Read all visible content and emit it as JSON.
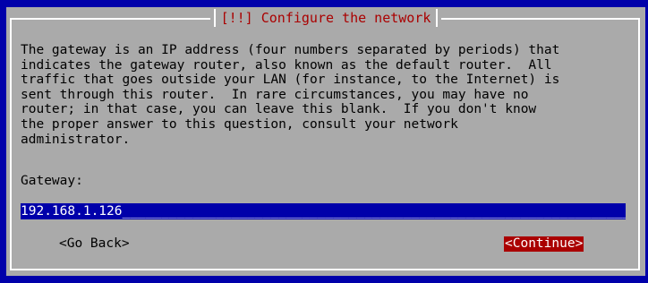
{
  "dialog": {
    "title": "[!!] Configure the network",
    "description": "The gateway is an IP address (four numbers separated by periods) that\nindicates the gateway router, also known as the default router.  All\ntraffic that goes outside your LAN (for instance, to the Internet) is\nsent through this router.  In rare circumstances, you may have no\nrouter; in that case, you can leave this blank.  If you don't know\nthe proper answer to this question, consult your network\nadministrator.",
    "field_label": "Gateway:",
    "field_value": "192.168.1.126"
  },
  "buttons": {
    "back": "<Go Back>",
    "continue": "<Continue>"
  },
  "colors": {
    "background": "#0000aa",
    "dialog": "#aaaaaa",
    "title": "#aa0000",
    "selected_button": "#aa0000",
    "input_bg": "#0000aa"
  }
}
